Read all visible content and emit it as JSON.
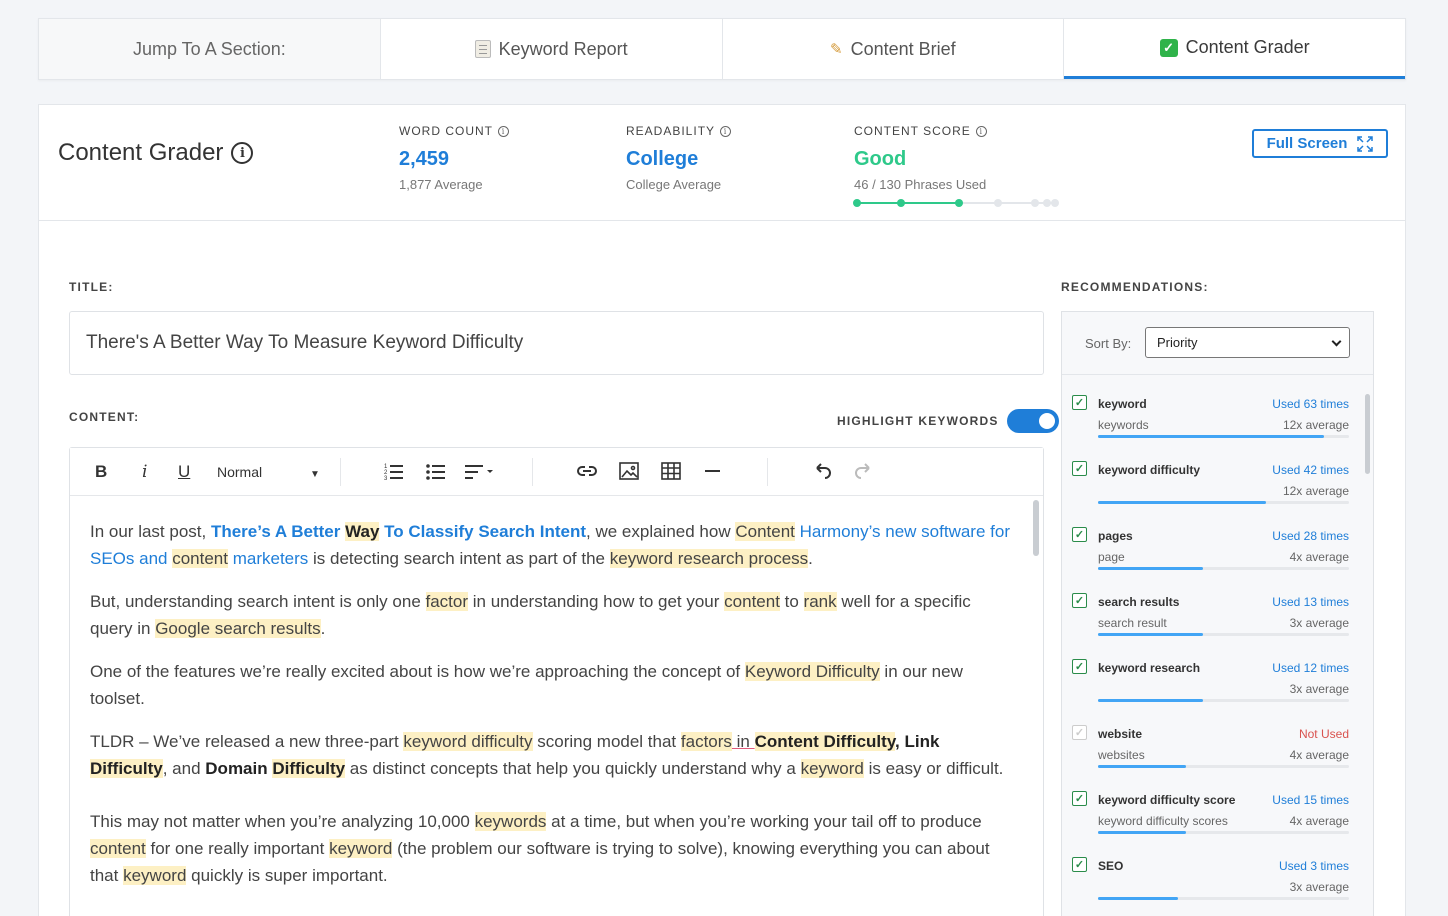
{
  "tabs": [
    {
      "label": "Jump To A Section:",
      "icon": "none"
    },
    {
      "label": "Keyword Report",
      "icon": "memo-icon"
    },
    {
      "label": "Content Brief",
      "icon": "pencil-note-icon"
    },
    {
      "label": "Content Grader",
      "icon": "check-icon",
      "active": true
    }
  ],
  "header": {
    "title": "Content Grader",
    "info_glyph": "i",
    "full_screen_label": "Full Screen",
    "metrics": {
      "word_count": {
        "label": "WORD COUNT",
        "value": "2,459",
        "sub": "1,877 Average"
      },
      "readability": {
        "label": "READABILITY",
        "value": "College",
        "sub": "College Average"
      },
      "content_score": {
        "label": "CONTENT SCORE",
        "value": "Good",
        "sub": "46 / 130 Phrases Used",
        "filled_steps": 3,
        "total_steps": 7
      }
    }
  },
  "labels": {
    "title": "TITLE:",
    "content": "CONTENT:",
    "highlight_keywords": "HIGHLIGHT KEYWORDS",
    "recommendations": "RECOMMENDATIONS:",
    "sort_by": "Sort By:"
  },
  "title_value": "There's A Better Way To Measure Keyword Difficulty",
  "highlight_enabled": true,
  "toolbar": {
    "bold": "B",
    "italic": "i",
    "underline": "U",
    "format_value": "Normal"
  },
  "content": {
    "p1": {
      "a": "In our last post, ",
      "b": "There’s A Better ",
      "c": "Way",
      "d": " To Classify Search Intent",
      "e": ", we explained how ",
      "f": "Content",
      "g": " Harmony’s new software for SEOs and ",
      "h": "content",
      "i": " marketers",
      "j": " is detecting search intent as part of the ",
      "k": "keyword research process",
      "l": "."
    },
    "p2": {
      "a": "But, understanding search intent is only one ",
      "b": "factor",
      "c": " in understanding how to get your ",
      "d": "content",
      "e": " to ",
      "f": "rank",
      "g": " well for a specific query in ",
      "h": "Google search results",
      "i": "."
    },
    "p3": {
      "a": "One of the features we’re really excited about is how we’re approaching the concept of ",
      "b": "Keyword Difficulty",
      "c": " in our new toolset."
    },
    "p4": {
      "a": "TLDR – We’ve released a new three-part ",
      "b": "keyword difficulty",
      "c": " scoring model that ",
      "d": "factors",
      "e": " in ",
      "f": "Content ",
      "g": "Difficulty",
      "h": ", ",
      "i": "Link ",
      "j": "Difficulty",
      "k": ", and ",
      "l": "Domain ",
      "m": "Difficulty",
      "n": " as distinct concepts that help you quickly understand why a ",
      "o": "keyword",
      "p": " is easy or difficult."
    },
    "p5": {
      "a": "This may not matter when you’re analyzing 10,000 ",
      "b": "keywords",
      "c": " at a time, but when you’re working your tail off to produce ",
      "d": "content",
      "e": " for one really important ",
      "f": "keyword",
      "g": " (the problem our software is trying to solve), knowing everything you can about that ",
      "h": "keyword",
      "i": " quickly is super important."
    }
  },
  "sort": {
    "value": "Priority"
  },
  "recommendations": [
    {
      "keyword": "keyword",
      "alt": "keywords",
      "used": "Used 63 times",
      "avg": "12x average",
      "checked": true,
      "fill": 0.9
    },
    {
      "keyword": "keyword difficulty",
      "alt": "",
      "used": "Used 42 times",
      "avg": "12x average",
      "checked": true,
      "fill": 0.67
    },
    {
      "keyword": "pages",
      "alt": "page",
      "used": "Used 28 times",
      "avg": "4x average",
      "checked": true,
      "fill": 0.42
    },
    {
      "keyword": "search results",
      "alt": "search result",
      "used": "Used 13 times",
      "avg": "3x average",
      "checked": true,
      "fill": 0.42
    },
    {
      "keyword": "keyword research",
      "alt": "",
      "used": "Used 12 times",
      "avg": "3x average",
      "checked": true,
      "fill": 0.42
    },
    {
      "keyword": "website",
      "alt": "websites",
      "used": "Not Used",
      "avg": "4x average",
      "checked": false,
      "fill": 0.35
    },
    {
      "keyword": "keyword difficulty score",
      "alt": "keyword difficulty scores",
      "used": "Used 15 times",
      "avg": "4x average",
      "checked": true,
      "fill": 0.35
    },
    {
      "keyword": "SEO",
      "alt": "",
      "used": "Used 3 times",
      "avg": "3x average",
      "checked": true,
      "fill": 0.32
    }
  ],
  "colors": {
    "accent": "#1f7ed8",
    "good": "#2ec98a",
    "highlight": "#fdf0c4",
    "not_used": "#d9534f"
  }
}
